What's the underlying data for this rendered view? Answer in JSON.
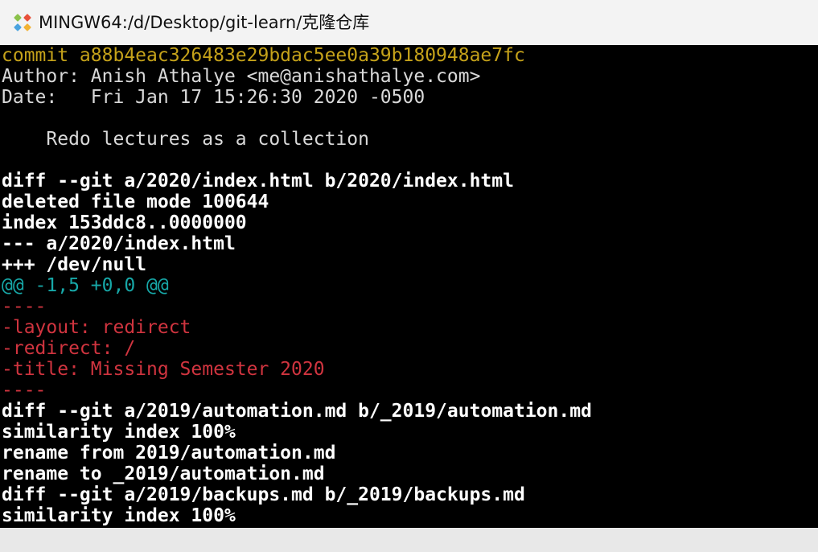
{
  "window": {
    "title": "MINGW64:/d/Desktop/git-learn/克隆仓库",
    "app_icon": "git-bash-icon"
  },
  "terminal": {
    "lines": [
      {
        "text": "commit a88b4eac326483e29bdac5ee0a39b180948ae7fc",
        "style": "commit"
      },
      {
        "text": "Author: Anish Athalye <me@anishathalye.com>",
        "style": "plain"
      },
      {
        "text": "Date:   Fri Jan 17 15:26:30 2020 -0500",
        "style": "plain"
      },
      {
        "text": "",
        "style": "plain"
      },
      {
        "text": "    Redo lectures as a collection",
        "style": "plain"
      },
      {
        "text": "",
        "style": "plain"
      },
      {
        "text": "diff --git a/2020/index.html b/2020/index.html",
        "style": "bold"
      },
      {
        "text": "deleted file mode 100644",
        "style": "bold"
      },
      {
        "text": "index 153ddc8..0000000",
        "style": "bold"
      },
      {
        "text": "--- a/2020/index.html",
        "style": "bold"
      },
      {
        "text": "+++ /dev/null",
        "style": "bold"
      },
      {
        "text": "@@ -1,5 +0,0 @@",
        "style": "hunk"
      },
      {
        "text": "----",
        "style": "del"
      },
      {
        "text": "-layout: redirect",
        "style": "del"
      },
      {
        "text": "-redirect: /",
        "style": "del"
      },
      {
        "text": "-title: Missing Semester 2020",
        "style": "del"
      },
      {
        "text": "----",
        "style": "del"
      },
      {
        "text": "diff --git a/2019/automation.md b/_2019/automation.md",
        "style": "bold"
      },
      {
        "text": "similarity index 100%",
        "style": "bold"
      },
      {
        "text": "rename from 2019/automation.md",
        "style": "bold"
      },
      {
        "text": "rename to _2019/automation.md",
        "style": "bold"
      },
      {
        "text": "diff --git a/2019/backups.md b/_2019/backups.md",
        "style": "bold"
      },
      {
        "text": "similarity index 100%",
        "style": "bold"
      }
    ]
  },
  "colors": {
    "commit": "#c5a21a",
    "hunk": "#17a8a8",
    "deleted": "#d0343f",
    "text": "#d9d9d9",
    "background": "#000000"
  }
}
